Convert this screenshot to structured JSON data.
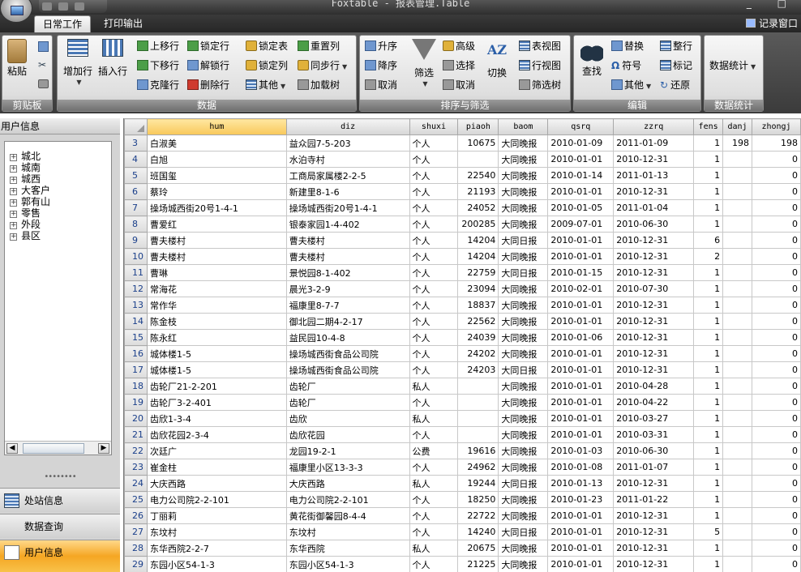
{
  "window": {
    "title": "Foxtable - 报表管理.Table",
    "controls": "_ □"
  },
  "tabs": [
    {
      "label": "日常工作"
    },
    {
      "label": "打印输出"
    }
  ],
  "log_window": "记录窗口",
  "ribbon": {
    "clipboard": {
      "label": "剪贴板",
      "paste": "粘贴"
    },
    "data": {
      "label": "数据",
      "add_row": "增加行",
      "insert_row": "插入行",
      "move_up": "上移行",
      "move_down": "下移行",
      "clone_row": "克隆行",
      "lock_row": "锁定行",
      "unlock_row": "解锁行",
      "delete_row": "删除行",
      "lock_table": "锁定表",
      "lock_col": "锁定列",
      "other": "其他",
      "reset_col": "重置列",
      "sync_row": "同步行",
      "add_tree": "加载树"
    },
    "sort_filter": {
      "label": "排序与筛选",
      "asc": "升序",
      "desc": "降序",
      "cancel_sort": "取消",
      "filter": "筛选",
      "advanced": "高级",
      "select": "选择",
      "cancel_filter": "取消",
      "switch": "切换",
      "table_view": "表视图",
      "row_view": "行视图",
      "filter_tree": "筛选树"
    },
    "edit": {
      "label": "编辑",
      "find": "查找",
      "replace": "替换",
      "symbol": "符号",
      "other": "其他",
      "tidy": "整行",
      "mark": "标记",
      "restore": "还原"
    },
    "stats": {
      "label": "数据统计",
      "button": "数据统计"
    }
  },
  "left_panel": {
    "title": "用户信息",
    "tree": [
      "城北",
      "城南",
      "城西",
      "大客户",
      "郭有山",
      "零售",
      "外段",
      "县区"
    ],
    "nav": [
      {
        "label": "处站信息"
      },
      {
        "label": "数据查询"
      },
      {
        "label": "用户信息"
      }
    ]
  },
  "grid": {
    "columns": [
      "hum",
      "diz",
      "shuxi",
      "piaoh",
      "baom",
      "qsrq",
      "zzrq",
      "fens",
      "danj",
      "zhongj"
    ],
    "rows": [
      [
        "3",
        "白淑美",
        "益众园7-5-203",
        "个人",
        "10675",
        "大同晚报",
        "2010-01-09",
        "2011-01-09",
        "1",
        "198",
        "198"
      ],
      [
        "4",
        "白旭",
        "水泊寺村",
        "个人",
        "",
        "大同晚报",
        "2010-01-01",
        "2010-12-31",
        "1",
        "",
        "0"
      ],
      [
        "5",
        "班国玺",
        "工商局家属楼2-2-5",
        "个人",
        "22540",
        "大同晚报",
        "2010-01-14",
        "2011-01-13",
        "1",
        "",
        "0"
      ],
      [
        "6",
        "蔡玲",
        "新建里8-1-6",
        "个人",
        "21193",
        "大同晚报",
        "2010-01-01",
        "2010-12-31",
        "1",
        "",
        "0"
      ],
      [
        "7",
        "操场城西街20号1-4-1",
        "操场城西街20号1-4-1",
        "个人",
        "24052",
        "大同晚报",
        "2010-01-05",
        "2011-01-04",
        "1",
        "",
        "0"
      ],
      [
        "8",
        "曹爱红",
        "银泰家园1-4-402",
        "个人",
        "200285",
        "大同晚报",
        "2009-07-01",
        "2010-06-30",
        "1",
        "",
        "0"
      ],
      [
        "9",
        "曹夫楼村",
        "曹夫楼村",
        "个人",
        "14204",
        "大同日报",
        "2010-01-01",
        "2010-12-31",
        "6",
        "",
        "0"
      ],
      [
        "10",
        "曹夫楼村",
        "曹夫楼村",
        "个人",
        "14204",
        "大同晚报",
        "2010-01-01",
        "2010-12-31",
        "2",
        "",
        "0"
      ],
      [
        "11",
        "曹琳",
        "景悦园8-1-402",
        "个人",
        "22759",
        "大同日报",
        "2010-01-15",
        "2010-12-31",
        "1",
        "",
        "0"
      ],
      [
        "12",
        "常海花",
        "晨光3-2-9",
        "个人",
        "23094",
        "大同晚报",
        "2010-02-01",
        "2010-07-30",
        "1",
        "",
        "0"
      ],
      [
        "13",
        "常作华",
        "福康里8-7-7",
        "个人",
        "18837",
        "大同晚报",
        "2010-01-01",
        "2010-12-31",
        "1",
        "",
        "0"
      ],
      [
        "14",
        "陈金枝",
        "御北园二期4-2-17",
        "个人",
        "22562",
        "大同晚报",
        "2010-01-01",
        "2010-12-31",
        "1",
        "",
        "0"
      ],
      [
        "15",
        "陈永红",
        "益民园10-4-8",
        "个人",
        "24039",
        "大同晚报",
        "2010-01-06",
        "2010-12-31",
        "1",
        "",
        "0"
      ],
      [
        "16",
        "城体楼1-5",
        "操场城西街食品公司院",
        "个人",
        "24202",
        "大同晚报",
        "2010-01-01",
        "2010-12-31",
        "1",
        "",
        "0"
      ],
      [
        "17",
        "城体楼1-5",
        "操场城西街食品公司院",
        "个人",
        "24203",
        "大同日报",
        "2010-01-01",
        "2010-12-31",
        "1",
        "",
        "0"
      ],
      [
        "18",
        "齿轮厂21-2-201",
        "齿轮厂",
        "私人",
        "",
        "大同晚报",
        "2010-01-01",
        "2010-04-28",
        "1",
        "",
        "0"
      ],
      [
        "19",
        "齿轮厂3-2-401",
        "齿轮厂",
        "个人",
        "",
        "大同晚报",
        "2010-01-01",
        "2010-04-22",
        "1",
        "",
        "0"
      ],
      [
        "20",
        "齿欣1-3-4",
        "齿欣",
        "私人",
        "",
        "大同晚报",
        "2010-01-01",
        "2010-03-27",
        "1",
        "",
        "0"
      ],
      [
        "21",
        "齿欣花园2-3-4",
        "齿欣花园",
        "个人",
        "",
        "大同晚报",
        "2010-01-01",
        "2010-03-31",
        "1",
        "",
        "0"
      ],
      [
        "22",
        "次廷广",
        "龙园19-2-1",
        "公费",
        "19616",
        "大同晚报",
        "2010-01-03",
        "2010-06-30",
        "1",
        "",
        "0"
      ],
      [
        "23",
        "崔金柱",
        "福康里小区13-3-3",
        "个人",
        "24962",
        "大同晚报",
        "2010-01-08",
        "2011-01-07",
        "1",
        "",
        "0"
      ],
      [
        "24",
        "大庆西路",
        "大庆西路",
        "私人",
        "19244",
        "大同日报",
        "2010-01-13",
        "2010-12-31",
        "1",
        "",
        "0"
      ],
      [
        "25",
        "电力公司院2-2-101",
        "电力公司院2-2-101",
        "个人",
        "18250",
        "大同晚报",
        "2010-01-23",
        "2011-01-22",
        "1",
        "",
        "0"
      ],
      [
        "26",
        "丁丽莉",
        "黄花街御馨园8-4-4",
        "个人",
        "22722",
        "大同晚报",
        "2010-01-01",
        "2010-12-31",
        "1",
        "",
        "0"
      ],
      [
        "27",
        "东坟村",
        "东坟村",
        "个人",
        "14240",
        "大同日报",
        "2010-01-01",
        "2010-12-31",
        "5",
        "",
        "0"
      ],
      [
        "28",
        "东华西院2-2-7",
        "东华西院",
        "私人",
        "20675",
        "大同晚报",
        "2010-01-01",
        "2010-12-31",
        "1",
        "",
        "0"
      ],
      [
        "29",
        "东园小区54-1-3",
        "东园小区54-1-3",
        "个人",
        "21225",
        "大同晚报",
        "2010-01-01",
        "2010-12-31",
        "1",
        "",
        "0"
      ]
    ]
  }
}
